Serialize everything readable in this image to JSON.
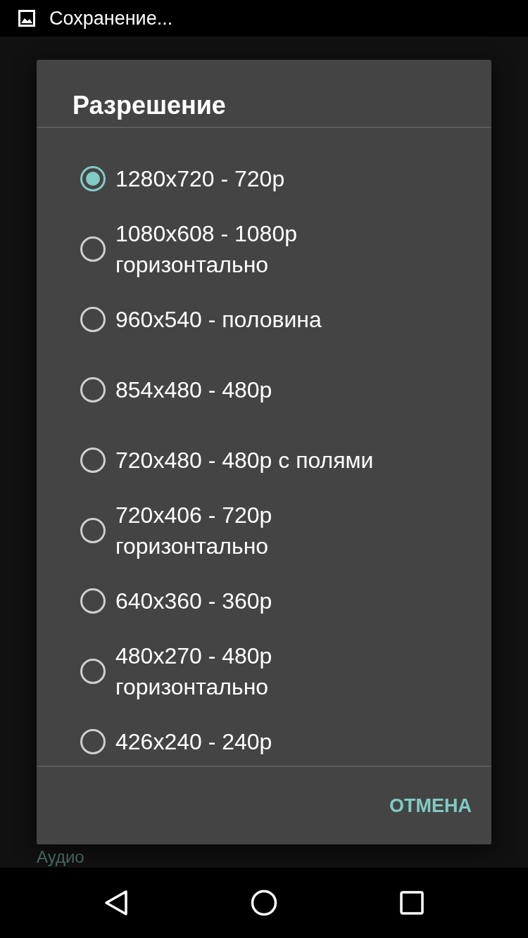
{
  "status_bar": {
    "notification": "Сохранение..."
  },
  "background": {
    "section_heading": "Аудио"
  },
  "dialog": {
    "title": "Разрешение",
    "options": [
      {
        "label": "1280x720 - 720p",
        "selected": true
      },
      {
        "label": "1080x608 - 1080p горизонтально",
        "selected": false
      },
      {
        "label": "960x540 - половина",
        "selected": false
      },
      {
        "label": "854x480 - 480p",
        "selected": false
      },
      {
        "label": "720x480 - 480p с полями",
        "selected": false
      },
      {
        "label": "720x406 - 720p горизонтально",
        "selected": false
      },
      {
        "label": "640x360 - 360p",
        "selected": false
      },
      {
        "label": "480x270 - 480p горизонтально",
        "selected": false
      },
      {
        "label": "426x240 - 240p",
        "selected": false
      }
    ],
    "buttons": [
      "ОТМЕНА"
    ]
  }
}
